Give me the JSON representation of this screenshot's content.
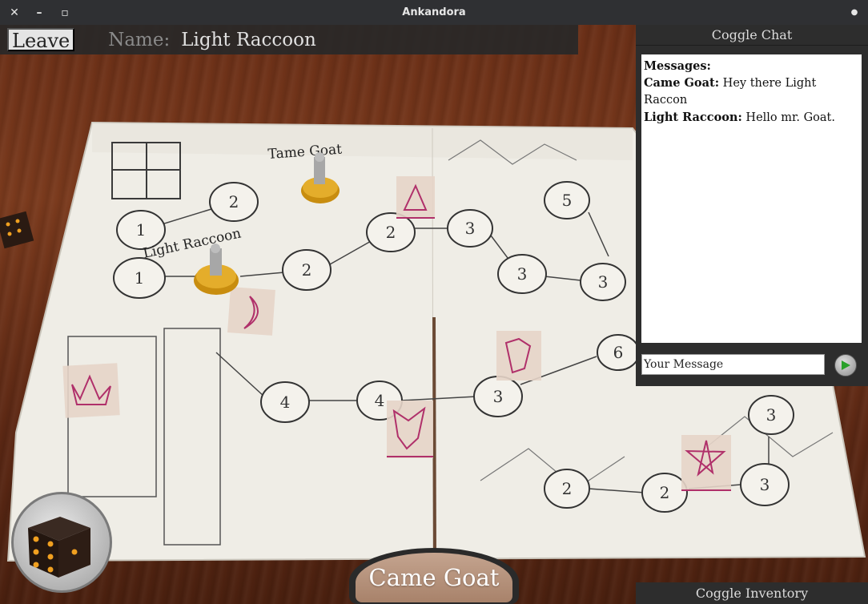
{
  "window": {
    "title": "Ankandora",
    "close_icon": "close-icon",
    "minimize_icon": "minimize-icon",
    "maximize_icon": "maximize-icon",
    "menu_icon": "menu-dot-icon"
  },
  "hud": {
    "leave_label": "Leave",
    "name_label": "Name:",
    "name_value": "Light Raccoon"
  },
  "chat": {
    "toggle_label": "Coggle Chat",
    "header": "Messages:",
    "messages": [
      {
        "author": "Came Goat:",
        "text": "Hey there Light Raccon"
      },
      {
        "author": "Light Raccoon:",
        "text": "Hello mr. Goat."
      }
    ],
    "input_value": "Your Message",
    "send_icon": "send-play-icon"
  },
  "inventory": {
    "toggle_label": "Coggle Inventory"
  },
  "turn": {
    "current_player": "Came Goat"
  },
  "board": {
    "player_labels": [
      "Tame Goat",
      "Light Raccoon"
    ],
    "space_numbers": [
      "1",
      "1",
      "2",
      "2",
      "2",
      "3",
      "5",
      "3",
      "3",
      "6",
      "4",
      "4",
      "3",
      "3",
      "2",
      "2",
      "3"
    ]
  },
  "colors": {
    "hud_bg": "#282828",
    "chat_bg": "#2d2d2d",
    "card_mark": "#b0306a",
    "send_arrow": "#2aa12a"
  }
}
